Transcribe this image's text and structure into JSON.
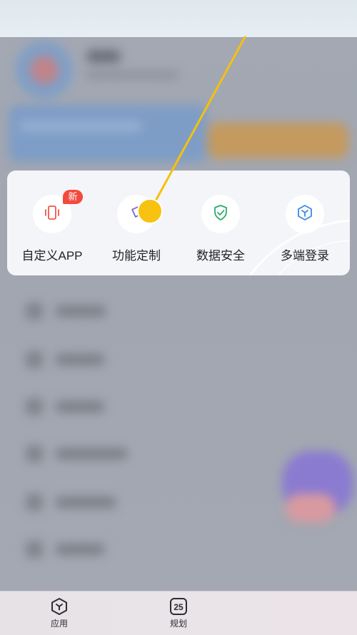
{
  "features": [
    {
      "label": "自定义APP",
      "icon": "phone-vibrate-icon",
      "badge": "新",
      "color": "#f0554b"
    },
    {
      "label": "功能定制",
      "icon": "tag-customize-icon",
      "color": "#7c67d6"
    },
    {
      "label": "数据安全",
      "icon": "shield-check-icon",
      "color": "#2bab6b"
    },
    {
      "label": "多端登录",
      "icon": "cube-icon",
      "color": "#3a8be8"
    }
  ],
  "tabbar": {
    "items": [
      {
        "label": "应用",
        "icon": "app-hexagon-icon"
      },
      {
        "label": "规划",
        "icon": "calendar-icon",
        "number": "25"
      }
    ]
  },
  "annotation": {
    "color": "#f5c10e"
  }
}
